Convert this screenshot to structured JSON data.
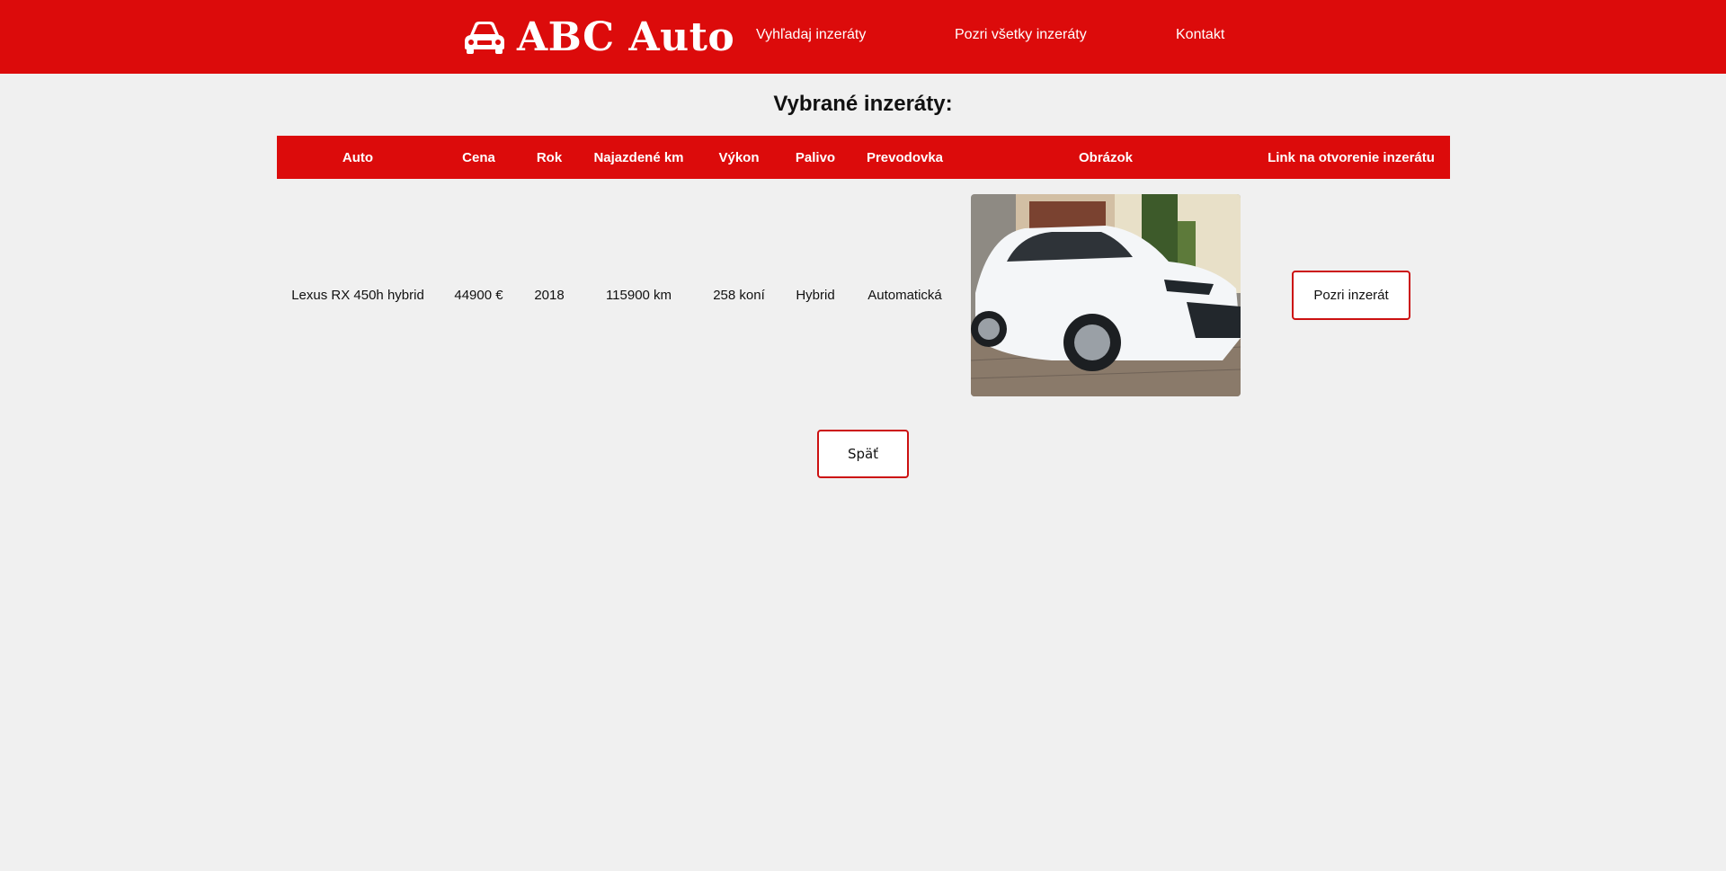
{
  "header": {
    "brand": "ABC Auto",
    "logo_icon": "car-icon",
    "nav": [
      {
        "label": "Vyhľadaj inzeráty"
      },
      {
        "label": "Pozri všetky inzeráty"
      },
      {
        "label": "Kontakt"
      }
    ],
    "accent_color": "#dc0b0b"
  },
  "page": {
    "title": "Vybrané inzeráty:"
  },
  "table": {
    "columns": [
      "Auto",
      "Cena",
      "Rok",
      "Najazdené km",
      "Výkon",
      "Palivo",
      "Prevodovka",
      "Obrázok",
      "Link na otvorenie inzerátu"
    ],
    "rows": [
      {
        "auto": "Lexus RX 450h hybrid",
        "cena": "44900 €",
        "rok": "2018",
        "km": "115900 km",
        "vykon": "258 koní",
        "palivo": "Hybrid",
        "prevodovka": "Automatická",
        "link_label": "Pozri inzerát"
      }
    ]
  },
  "footer_actions": {
    "back_label": "Späť"
  }
}
